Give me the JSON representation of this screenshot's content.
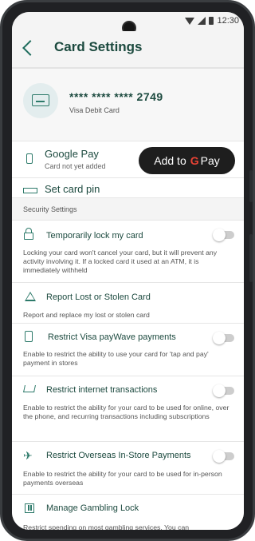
{
  "status_bar": {
    "time": "12:30"
  },
  "header": {
    "title": "Card Settings"
  },
  "card": {
    "masked_number": "**** **** **** 2749",
    "type": "Visa Debit Card"
  },
  "google_pay": {
    "title": "Google Pay",
    "subtitle": "Card not yet added",
    "button_text": "Add to",
    "button_g": "G",
    "button_pay": "Pay"
  },
  "set_pin": {
    "label": "Set card pin"
  },
  "security": {
    "section_label": "Security Settings",
    "items": [
      {
        "title": "Temporarily lock my card",
        "desc": "Locking your card won't cancel your card, but it will prevent any activity involving it. If a locked card it used at an ATM, it is immediately withheld",
        "toggle": "off"
      },
      {
        "title": "Report Lost or Stolen Card",
        "desc": "Report and replace my lost or stolen card"
      },
      {
        "title": "Restrict Visa payWave payments",
        "desc": "Enable to restrict the ability to use your card for 'tap and pay' payment in stores",
        "toggle": "off"
      },
      {
        "title": "Restrict internet transactions",
        "desc": "Enable to restrict the ability for your card to be used for online, over the phone, and recurring transactions including subscriptions",
        "toggle": "off"
      },
      {
        "title": "Restrict Overseas In-Store Payments",
        "desc": "Enable to restrict the ability for your card to be used for in-person payments overseas",
        "toggle": "off"
      },
      {
        "title": "Manage Gambling Lock",
        "desc": "Restrict spending on most gambling services. You can"
      }
    ]
  },
  "colors": {
    "accent": "#1c4a3f",
    "icon": "#2d7a6a",
    "toggle_off": "#cdcdcd"
  },
  "icons": [
    "back-arrow-icon",
    "card-icon",
    "phone-icon",
    "google-pay-logo",
    "keypad-icon",
    "lock-icon",
    "warning-icon",
    "tap-card-icon",
    "cart-icon",
    "airplane-icon",
    "gambling-icon"
  ]
}
